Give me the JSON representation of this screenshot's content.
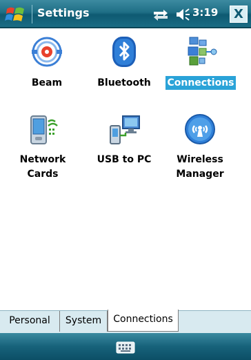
{
  "titlebar": {
    "title": "Settings",
    "time": "3:19",
    "close_label": "X",
    "start_icon": "windows-start-icon",
    "connectivity_icon": "connectivity-icon",
    "volume_icon": "volume-icon"
  },
  "items": [
    {
      "label": "Beam",
      "icon": "beam-icon",
      "selected": false
    },
    {
      "label": "Bluetooth",
      "icon": "bluetooth-icon",
      "selected": false
    },
    {
      "label": "Connections",
      "icon": "connections-icon",
      "selected": true
    },
    {
      "label_line1": "Network",
      "label_line2": "Cards",
      "icon": "network-cards-icon",
      "selected": false
    },
    {
      "label": "USB to PC",
      "icon": "usb-to-pc-icon",
      "selected": false
    },
    {
      "label_line1": "Wireless",
      "label_line2": "Manager",
      "icon": "wireless-manager-icon",
      "selected": false
    }
  ],
  "tabs": {
    "personal": "Personal",
    "system": "System",
    "connections": "Connections",
    "active": "Connections"
  },
  "bottombar": {
    "keyboard_icon": "keyboard-icon"
  },
  "colors": {
    "titlebar": "#1f6f86",
    "selection": "#2aa3d8",
    "tabbar": "#d8eaf0"
  }
}
